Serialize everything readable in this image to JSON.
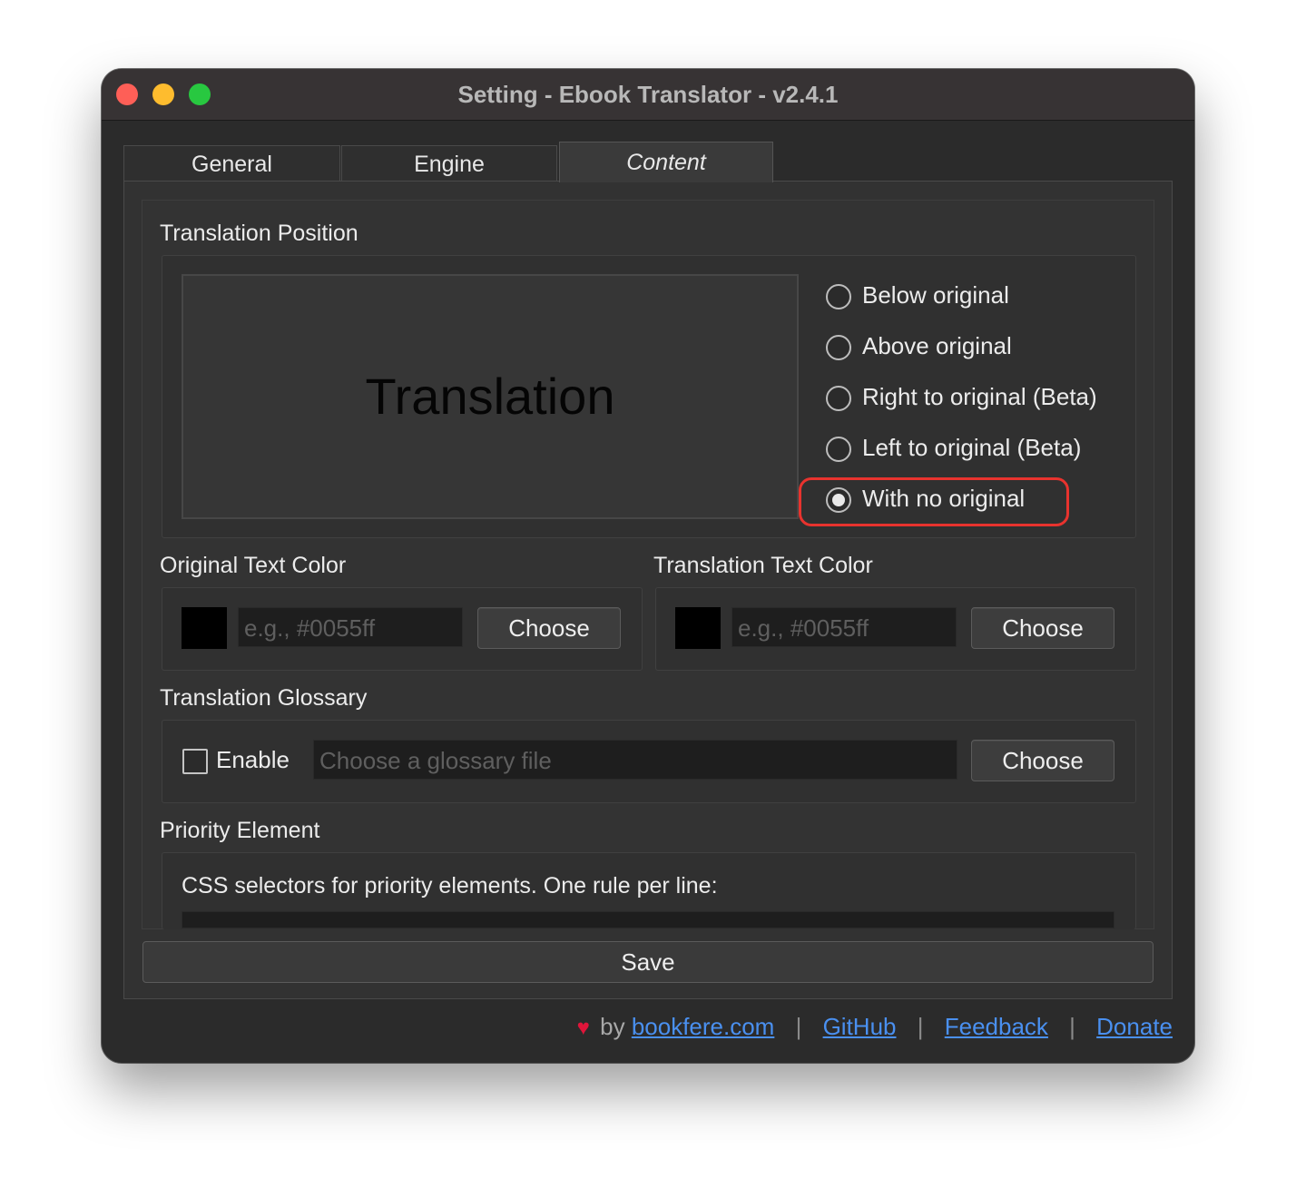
{
  "window": {
    "title": "Setting - Ebook Translator - v2.4.1"
  },
  "tabs": [
    {
      "label": "General",
      "active": false
    },
    {
      "label": "Engine",
      "active": false
    },
    {
      "label": "Content",
      "active": true
    }
  ],
  "translation_position": {
    "title": "Translation Position",
    "preview_text": "Translation",
    "options": [
      {
        "label": "Below original",
        "checked": false
      },
      {
        "label": "Above original",
        "checked": false
      },
      {
        "label": "Right to original (Beta)",
        "checked": false
      },
      {
        "label": "Left to original (Beta)",
        "checked": false
      },
      {
        "label": "With no original",
        "checked": true
      }
    ]
  },
  "original_color": {
    "title": "Original Text Color",
    "placeholder": "e.g., #0055ff",
    "swatch_color": "#000000",
    "button": "Choose"
  },
  "translation_color": {
    "title": "Translation Text Color",
    "placeholder": "e.g., #0055ff",
    "swatch_color": "#000000",
    "button": "Choose"
  },
  "glossary": {
    "title": "Translation Glossary",
    "enable_label": "Enable",
    "enabled": false,
    "placeholder": "Choose a glossary file",
    "button": "Choose"
  },
  "priority": {
    "title": "Priority Element",
    "description": "CSS selectors for priority elements. One rule per line:"
  },
  "save_label": "Save",
  "footer": {
    "by": "by",
    "links": [
      "bookfere.com",
      "GitHub",
      "Feedback",
      "Donate"
    ],
    "separator": "|"
  },
  "colors": {
    "highlight": "#e8332e",
    "link": "#4a90f0",
    "heart": "#e0153a"
  }
}
